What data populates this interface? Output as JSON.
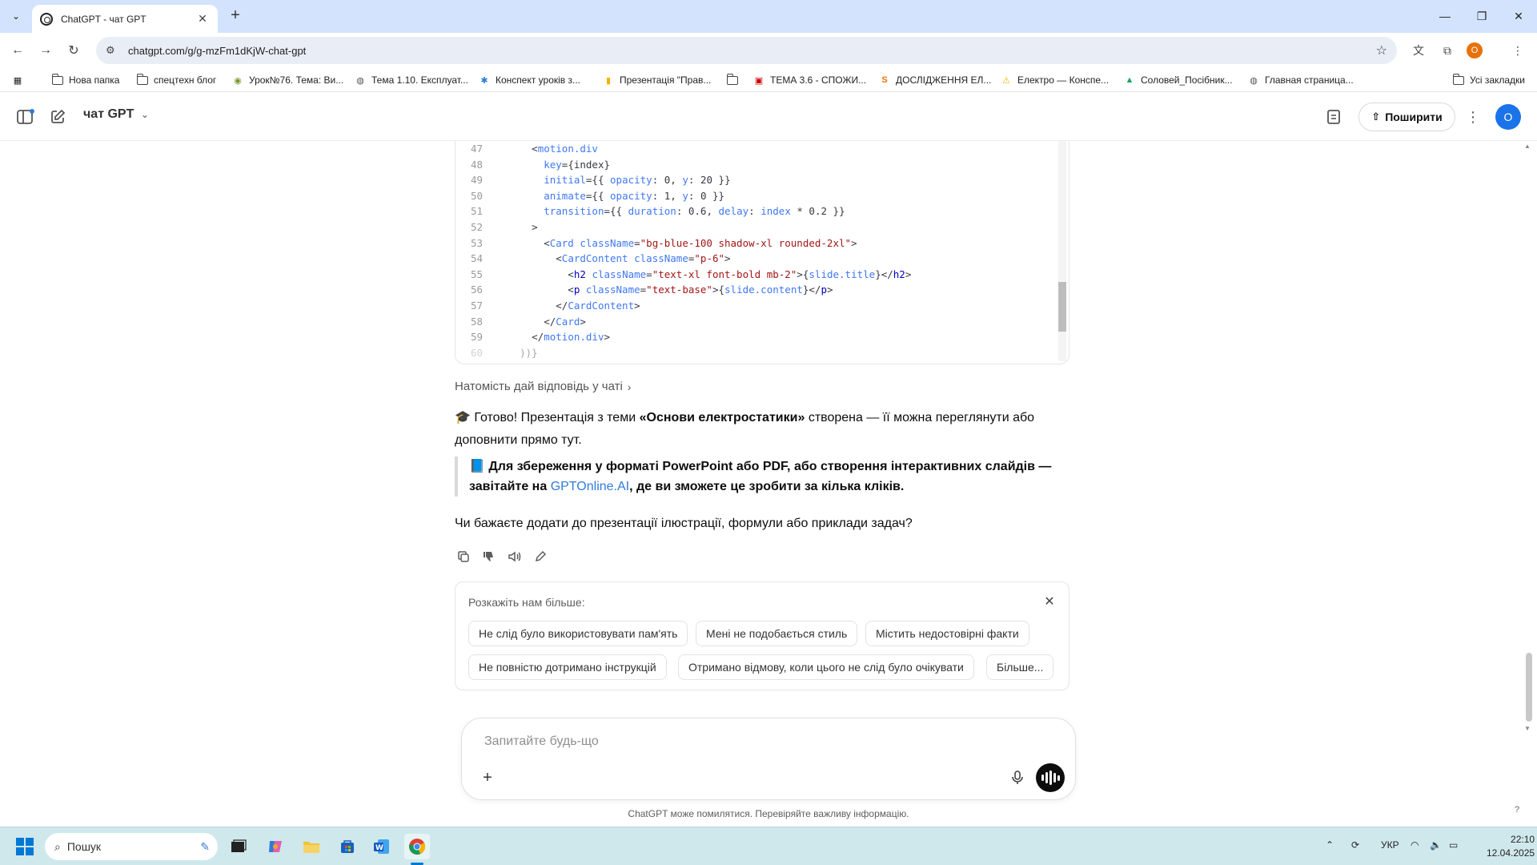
{
  "browser": {
    "tab_title": "ChatGPT - чат GPT",
    "url": "chatgpt.com/g/g-mzFm1dKjW-chat-gpt",
    "all_bookmarks": "Усі закладки",
    "profile_letter": "O",
    "bookmarks": [
      {
        "label": "Нова папка",
        "icon": "folder-icon"
      },
      {
        "label": "спецтехн блог",
        "icon": "folder-icon"
      },
      {
        "label": "Урок№76. Тема: Ви...",
        "icon": "site-icon"
      },
      {
        "label": "Тема 1.10. Експлуат...",
        "icon": "site-icon"
      },
      {
        "label": "Конспект уроків з...",
        "icon": "site-icon"
      },
      {
        "label": "Презентація \"Прав...",
        "icon": "site-icon"
      },
      {
        "label": "",
        "icon": "folder-icon"
      },
      {
        "label": "ТЕМА 3.6 - СПОЖИ...",
        "icon": "site-icon"
      },
      {
        "label": "ДОСЛІДЖЕННЯ ЕЛ...",
        "icon": "site-icon"
      },
      {
        "label": "Електро — Конспе...",
        "icon": "warning-icon"
      },
      {
        "label": "Соловей_Посібник...",
        "icon": "drive-icon"
      },
      {
        "label": "Главная страница...",
        "icon": "site-icon"
      }
    ]
  },
  "header": {
    "model_name": "чат GPT",
    "share_label": "Поширити",
    "avatar_letter": "O"
  },
  "code": {
    "lines": [
      {
        "n": "47",
        "segs": [
          [
            "      ",
            "#383a42"
          ],
          [
            "<",
            "#383a42"
          ],
          [
            "motion.div",
            "#4078f2"
          ]
        ]
      },
      {
        "n": "48",
        "segs": [
          [
            "        ",
            "#383a42"
          ],
          [
            "key",
            "#4078f2"
          ],
          [
            "={index}",
            "#383a42"
          ]
        ]
      },
      {
        "n": "49",
        "segs": [
          [
            "        ",
            "#383a42"
          ],
          [
            "initial",
            "#4078f2"
          ],
          [
            "={{ ",
            "#383a42"
          ],
          [
            "opacity",
            "#4078f2"
          ],
          [
            ": ",
            "#383a42"
          ],
          [
            "0",
            "#383a42"
          ],
          [
            ", ",
            "#383a42"
          ],
          [
            "y",
            "#4078f2"
          ],
          [
            ": ",
            "#383a42"
          ],
          [
            "20",
            "#383a42"
          ],
          [
            " }}",
            "#383a42"
          ]
        ]
      },
      {
        "n": "50",
        "segs": [
          [
            "        ",
            "#383a42"
          ],
          [
            "animate",
            "#4078f2"
          ],
          [
            "={{ ",
            "#383a42"
          ],
          [
            "opacity",
            "#4078f2"
          ],
          [
            ": ",
            "#383a42"
          ],
          [
            "1",
            "#383a42"
          ],
          [
            ", ",
            "#383a42"
          ],
          [
            "y",
            "#4078f2"
          ],
          [
            ": ",
            "#383a42"
          ],
          [
            "0",
            "#383a42"
          ],
          [
            " }}",
            "#383a42"
          ]
        ]
      },
      {
        "n": "51",
        "segs": [
          [
            "        ",
            "#383a42"
          ],
          [
            "transition",
            "#4078f2"
          ],
          [
            "={{ ",
            "#383a42"
          ],
          [
            "duration",
            "#4078f2"
          ],
          [
            ": ",
            "#383a42"
          ],
          [
            "0.6",
            "#383a42"
          ],
          [
            ", ",
            "#383a42"
          ],
          [
            "delay",
            "#4078f2"
          ],
          [
            ": ",
            "#383a42"
          ],
          [
            "index",
            "#4078f2"
          ],
          [
            " * 0.2 }}",
            "#383a42"
          ]
        ]
      },
      {
        "n": "52",
        "segs": [
          [
            "      >",
            "#383a42"
          ]
        ]
      },
      {
        "n": "53",
        "segs": [
          [
            "        <",
            "#383a42"
          ],
          [
            "Card",
            "#4078f2"
          ],
          [
            " ",
            "#383a42"
          ],
          [
            "className",
            "#4078f2"
          ],
          [
            "=",
            "#383a42"
          ],
          [
            "\"bg-blue-100 shadow-xl rounded-2xl\"",
            "#a31515"
          ],
          [
            ">",
            "#383a42"
          ]
        ]
      },
      {
        "n": "54",
        "segs": [
          [
            "          <",
            "#383a42"
          ],
          [
            "CardContent",
            "#4078f2"
          ],
          [
            " ",
            "#383a42"
          ],
          [
            "className",
            "#4078f2"
          ],
          [
            "=",
            "#383a42"
          ],
          [
            "\"p-6\"",
            "#a31515"
          ],
          [
            ">",
            "#383a42"
          ]
        ]
      },
      {
        "n": "55",
        "segs": [
          [
            "            <",
            "#383a42"
          ],
          [
            "h2",
            "#0000c0"
          ],
          [
            " ",
            "#383a42"
          ],
          [
            "className",
            "#4078f2"
          ],
          [
            "=",
            "#383a42"
          ],
          [
            "\"text-xl font-bold mb-2\"",
            "#a31515"
          ],
          [
            ">{",
            "#383a42"
          ],
          [
            "slide.title",
            "#4078f2"
          ],
          [
            "}</",
            "#383a42"
          ],
          [
            "h2",
            "#0000c0"
          ],
          [
            ">",
            "#383a42"
          ]
        ]
      },
      {
        "n": "56",
        "segs": [
          [
            "            <",
            "#383a42"
          ],
          [
            "p",
            "#0000c0"
          ],
          [
            " ",
            "#383a42"
          ],
          [
            "className",
            "#4078f2"
          ],
          [
            "=",
            "#383a42"
          ],
          [
            "\"text-base\"",
            "#a31515"
          ],
          [
            ">{",
            "#383a42"
          ],
          [
            "slide.content",
            "#4078f2"
          ],
          [
            "}</",
            "#383a42"
          ],
          [
            "p",
            "#0000c0"
          ],
          [
            ">",
            "#383a42"
          ]
        ]
      },
      {
        "n": "57",
        "segs": [
          [
            "          </",
            "#383a42"
          ],
          [
            "CardContent",
            "#4078f2"
          ],
          [
            ">",
            "#383a42"
          ]
        ]
      },
      {
        "n": "58",
        "segs": [
          [
            "        </",
            "#383a42"
          ],
          [
            "Card",
            "#4078f2"
          ],
          [
            ">",
            "#383a42"
          ]
        ]
      },
      {
        "n": "59",
        "segs": [
          [
            "      </",
            "#383a42"
          ],
          [
            "motion.div",
            "#4078f2"
          ],
          [
            ">",
            "#383a42"
          ]
        ]
      },
      {
        "n": "60",
        "segs": [
          [
            "    ))}",
            "#383a42"
          ]
        ]
      }
    ]
  },
  "conversation": {
    "reply_in_chat": "Натомість дай відповідь у чаті",
    "msg_emoji": "🎓",
    "msg_part1": " Готово! Презентація з теми ",
    "msg_bold": "«Основи електростатики»",
    "msg_part2": " створена — її можна переглянути або доповнити прямо тут.",
    "quote_emoji": "📘",
    "quote_part1": " Для збереження у форматі PowerPoint або PDF, або створення інтерактивних слайдів — завітайте на ",
    "quote_link": "GPTOnline.AI",
    "quote_part2": ", де ви зможете це зробити за кілька кліків.",
    "followup": "Чи бажаєте додати до презентації ілюстрації, формули або приклади задач?"
  },
  "feedback": {
    "title": "Розкажіть нам більше:",
    "chips_row1": [
      "Не слід було використовувати пам'ять",
      "Мені не подобається стиль",
      "Містить недостовірні факти"
    ],
    "chips_row2": [
      "Не повністю дотримано інструкцій",
      "Отримано відмову, коли цього не слід було очікувати",
      "Більше..."
    ]
  },
  "composer": {
    "placeholder": "Запитайте будь-що",
    "disclaimer": "ChatGPT може помилятися. Перевіряйте важливу інформацію."
  },
  "taskbar": {
    "search_label": "Пошук",
    "language": "УКР",
    "time": "22:10",
    "date": "12.04.2025"
  }
}
